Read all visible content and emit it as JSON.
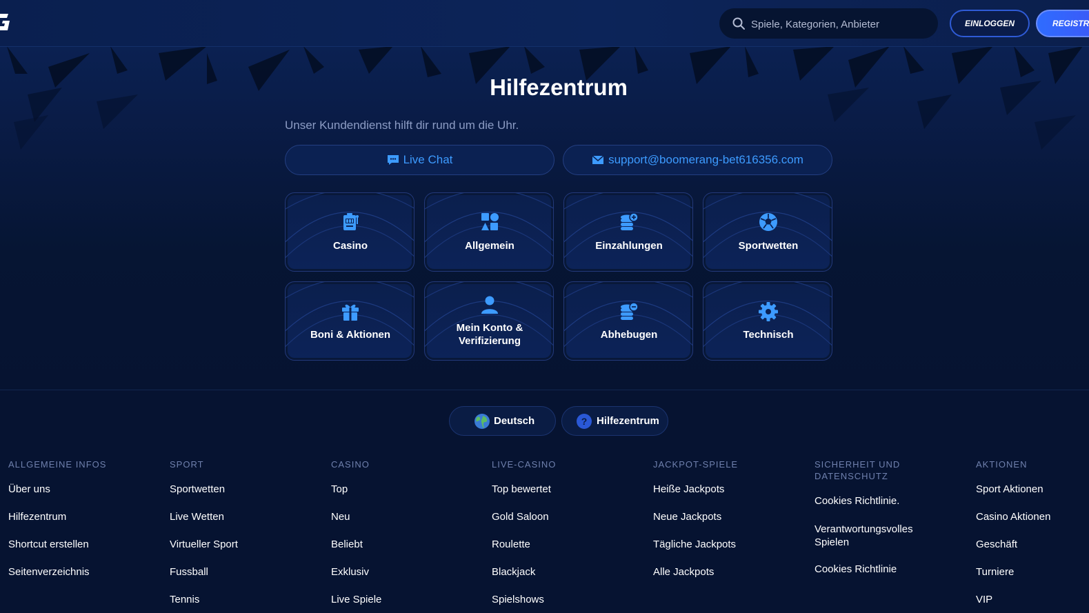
{
  "header": {
    "logo_icon": "brand-logo-icon",
    "search": {
      "placeholder": "Spiele, Kategorien, Anbieter",
      "icon": "search-icon"
    },
    "login_label": "EINLOGGEN",
    "register_label": "REGISTRIEREN"
  },
  "hero": {
    "title": "Hilfezentrum",
    "subtitle": "Unser Kundendienst hilft dir rund um die Uhr.",
    "live_chat_label": "Live Chat",
    "email_label": "support@boomerang-bet616356.com",
    "accent_color": "#3d9bff",
    "categories": [
      {
        "label": "Casino",
        "icon": "slot-machine-icon"
      },
      {
        "label": "Allgemein",
        "icon": "shapes-icon"
      },
      {
        "label": "Einzahlungen",
        "icon": "coins-plus-icon"
      },
      {
        "label": "Sportwetten",
        "icon": "soccer-ball-icon"
      },
      {
        "label": "Boni & Aktionen",
        "icon": "gift-icon"
      },
      {
        "label": "Mein Konto & Verifizierung",
        "icon": "user-icon"
      },
      {
        "label": "Abhebugen",
        "icon": "coins-minus-icon"
      },
      {
        "label": "Technisch",
        "icon": "gear-icon"
      }
    ]
  },
  "footer": {
    "language_label": "Deutsch",
    "help_label": "Hilfezentrum",
    "columns": [
      {
        "title": "ALLGEMEINE INFOS",
        "links": [
          "Über uns",
          "Hilfezentrum",
          "Shortcut erstellen",
          "Seitenverzeichnis"
        ]
      },
      {
        "title": "SPORT",
        "links": [
          "Sportwetten",
          "Live Wetten",
          "Virtueller Sport",
          "Fussball",
          "Tennis"
        ]
      },
      {
        "title": "CASINO",
        "links": [
          "Top",
          "Neu",
          "Beliebt",
          "Exklusiv",
          "Live Spiele"
        ]
      },
      {
        "title": "LIVE-CASINO",
        "links": [
          "Top bewertet",
          "Gold Saloon",
          "Roulette",
          "Blackjack",
          "Spielshows"
        ]
      },
      {
        "title": "JACKPOT-SPIELE",
        "links": [
          "Heiße Jackpots",
          "Neue Jackpots",
          "Tägliche Jackpots",
          "Alle Jackpots"
        ]
      },
      {
        "title": "SICHERHEIT UND DATENSCHUTZ",
        "links": [
          "Cookies Richtlinie.",
          "Verantwortungsvolles Spielen",
          "Cookies Richtlinie"
        ]
      },
      {
        "title": "AKTIONEN",
        "links": [
          "Sport Aktionen",
          "Casino Aktionen",
          "Geschäft",
          "Turniere",
          "VIP"
        ]
      }
    ]
  }
}
